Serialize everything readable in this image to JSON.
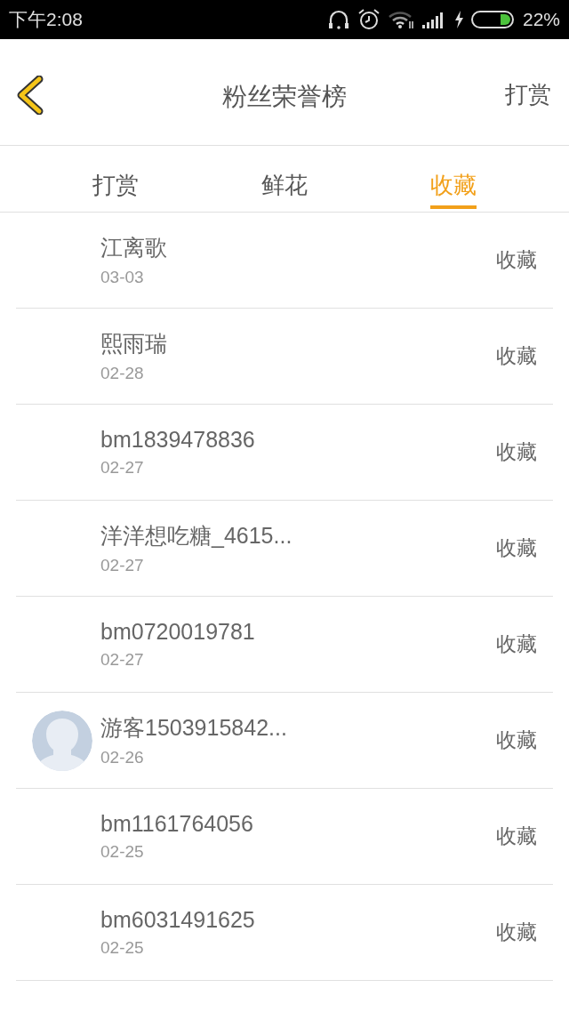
{
  "status_bar": {
    "time": "下午2:08",
    "battery": "22%"
  },
  "header": {
    "title": "粉丝荣誉榜",
    "action": "打赏"
  },
  "tabs": [
    {
      "label": "打赏",
      "selected": false
    },
    {
      "label": "鲜花",
      "selected": false
    },
    {
      "label": "收藏",
      "selected": true
    }
  ],
  "rows": [
    {
      "name": "江离歌",
      "date": "03-03",
      "action": "收藏",
      "avatar": false
    },
    {
      "name": "熙雨瑞",
      "date": "02-28",
      "action": "收藏",
      "avatar": false
    },
    {
      "name": "bm1839478836",
      "date": "02-27",
      "action": "收藏",
      "avatar": false
    },
    {
      "name": "洋洋想吃糖_4615...",
      "date": "02-27",
      "action": "收藏",
      "avatar": false
    },
    {
      "name": "bm0720019781",
      "date": "02-27",
      "action": "收藏",
      "avatar": false
    },
    {
      "name": "游客1503915842...",
      "date": "02-26",
      "action": "收藏",
      "avatar": true
    },
    {
      "name": "bm1161764056",
      "date": "02-25",
      "action": "收藏",
      "avatar": false
    },
    {
      "name": "bm6031491625",
      "date": "02-25",
      "action": "收藏",
      "avatar": false
    }
  ]
}
